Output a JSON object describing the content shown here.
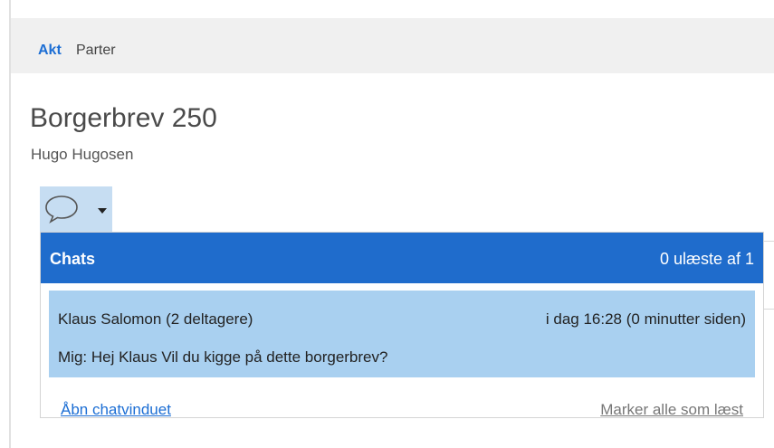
{
  "tabs": {
    "akt": "Akt",
    "parter": "Parter"
  },
  "document": {
    "title": "Borgerbrev 250",
    "subtitle": "Hugo Hugosen"
  },
  "chat_button": {
    "icon": "speech-bubble-icon",
    "dropdown_icon": "caret-down-icon"
  },
  "chats_panel": {
    "title": "Chats",
    "unread_count": "0 ulæste af 1",
    "items": [
      {
        "name": "Klaus Salomon (2 deltagere)",
        "time": "i dag 16:28 (0 minutter siden)",
        "message": "Mig: Hej Klaus  Vil du kigge på dette borgerbrev?"
      }
    ],
    "open_link": "Åbn chatvinduet",
    "mark_all_read": "Marker alle som læst"
  },
  "colors": {
    "accent": "#1f6ccc",
    "selected_item": "#a9d0f0",
    "button_bg": "#c6ddf2",
    "tabbar_bg": "#f0f0f0"
  }
}
